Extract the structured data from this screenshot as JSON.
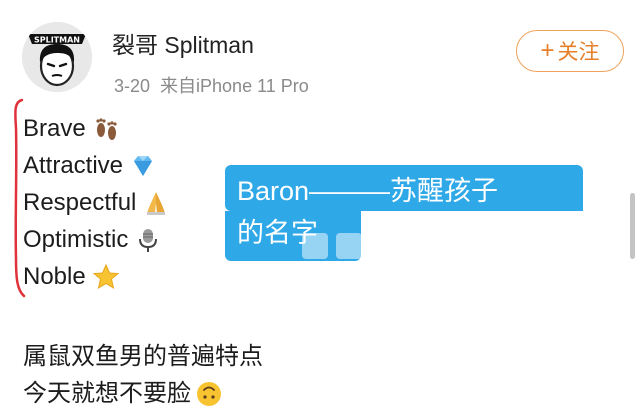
{
  "post": {
    "author_name": "裂哥 Splitman",
    "date": "3-20",
    "source": "来自iPhone 11 Pro",
    "follow_label": "关注",
    "avatar_text": "SPLITMAN"
  },
  "traits": [
    {
      "label": "Brave",
      "icon": "footprints-icon"
    },
    {
      "label": "Attractive",
      "icon": "gem-icon"
    },
    {
      "label": "Respectful",
      "icon": "folded-hands-icon"
    },
    {
      "label": "Optimistic",
      "icon": "microphone-icon"
    },
    {
      "label": "Noble",
      "icon": "star-icon"
    }
  ],
  "caption": {
    "line1": "Baron———苏醒孩子",
    "line2": "的名字"
  },
  "body": {
    "line1": "属鼠双鱼男的普遍特点",
    "line2": "今天就想不要脸",
    "line2_icon": "upside-down-face-icon"
  },
  "colors": {
    "follow_accent": "#e57f2a",
    "caption_bg": "#2fa8e8",
    "bracket": "#e0323a"
  }
}
